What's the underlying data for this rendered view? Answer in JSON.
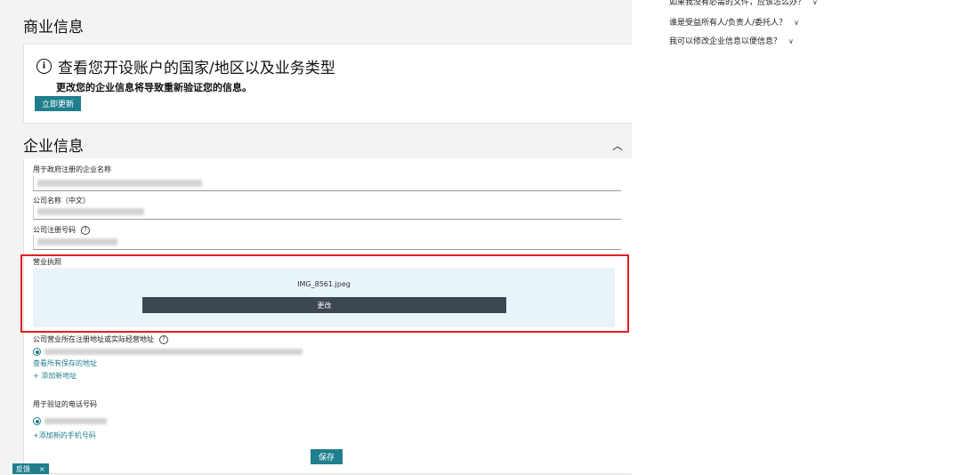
{
  "faq": [
    {
      "text": "如果我没有必需的文件，应该怎么办？"
    },
    {
      "text": "谁是受益所有人/负责人/委托人？"
    },
    {
      "text": "我可以修改企业信息以便信息？"
    }
  ],
  "business_info": {
    "title": "商业信息",
    "notice_title": "查看您开设账户的国家/地区以及业务类型",
    "notice_sub": "更改您的企业信息将导致重新验证您的信息。",
    "button_label": "立即更新"
  },
  "company_info": {
    "title": "企业信息",
    "collapse_glyph": "︿",
    "fields": [
      {
        "label": "用于政府注册的企业名称"
      },
      {
        "label": "公司名称（中文）"
      },
      {
        "label": "公司注册号码"
      }
    ],
    "license_label": "营业执照",
    "license_file": "IMG_8561.jpeg",
    "change_label": "更改",
    "address_label": "公司营业所在注册地址或实际经营地址",
    "view_addresses": "查看所有保存的地址",
    "add_address": "+ 添加新地址",
    "phone_label": "用于验证的电话号码",
    "add_phone": "+添加新的手机号码",
    "save_label": "保存"
  },
  "toast": {
    "label": "反馈",
    "close": "×"
  }
}
